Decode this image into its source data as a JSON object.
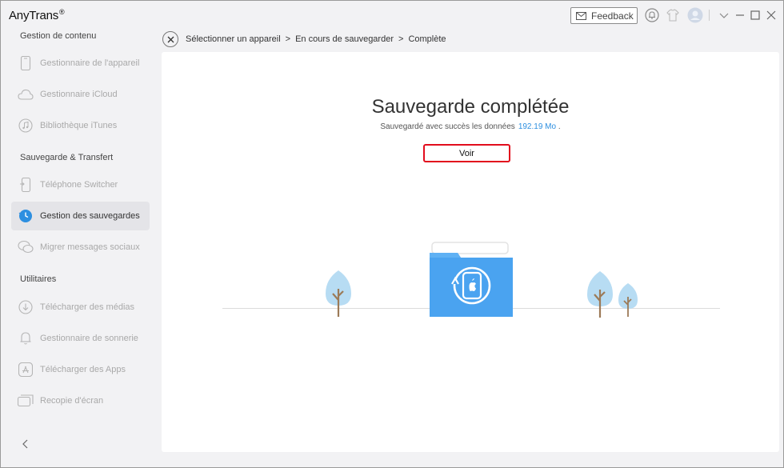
{
  "app": {
    "name": "AnyTrans",
    "registered_mark": "®"
  },
  "titlebar": {
    "feedback_label": "Feedback",
    "icons": [
      "mail-icon",
      "bell-icon",
      "tshirt-icon",
      "user-avatar-icon",
      "chevron-down-icon",
      "minimize-icon",
      "maximize-icon",
      "close-icon"
    ]
  },
  "sidebar": {
    "sections": [
      {
        "title": "Gestion de contenu"
      },
      {
        "title": "Sauvegarde & Transfert"
      },
      {
        "title": "Utilitaires"
      }
    ],
    "items": [
      {
        "label": "Gestionnaire de l'appareil",
        "icon": "phone-icon"
      },
      {
        "label": "Gestionnaire iCloud",
        "icon": "cloud-icon"
      },
      {
        "label": "Bibliothèque iTunes",
        "icon": "music-note-icon"
      },
      {
        "label": "Téléphone Switcher",
        "icon": "phone-switch-icon"
      },
      {
        "label": "Gestion des sauvegardes",
        "icon": "backup-clock-icon",
        "active": true
      },
      {
        "label": "Migrer messages sociaux",
        "icon": "chat-bubbles-icon"
      },
      {
        "label": "Télécharger des médias",
        "icon": "download-icon"
      },
      {
        "label": "Gestionnaire de sonnerie",
        "icon": "bell-icon"
      },
      {
        "label": "Télécharger des Apps",
        "icon": "app-store-icon"
      },
      {
        "label": "Recopie d'écran",
        "icon": "screen-mirror-icon"
      }
    ],
    "collapse_icon": "chevron-left-icon"
  },
  "breadcrumb": {
    "steps": [
      "Sélectionner un appareil",
      "En cours de sauvegarder",
      "Complète"
    ],
    "separator": ">"
  },
  "main": {
    "title": "Sauvegarde complétée",
    "subtitle": "Sauvegardé avec succès les données",
    "size": "192.19 Mo",
    "subtitle_end": ".",
    "view_button": "Voir"
  },
  "colors": {
    "accent_blue": "#2d8fe0",
    "highlight_red": "#e20d1d",
    "folder_blue": "#4aa3f0",
    "tree_blue": "#b7dcf3",
    "tree_trunk": "#9c7a57"
  }
}
